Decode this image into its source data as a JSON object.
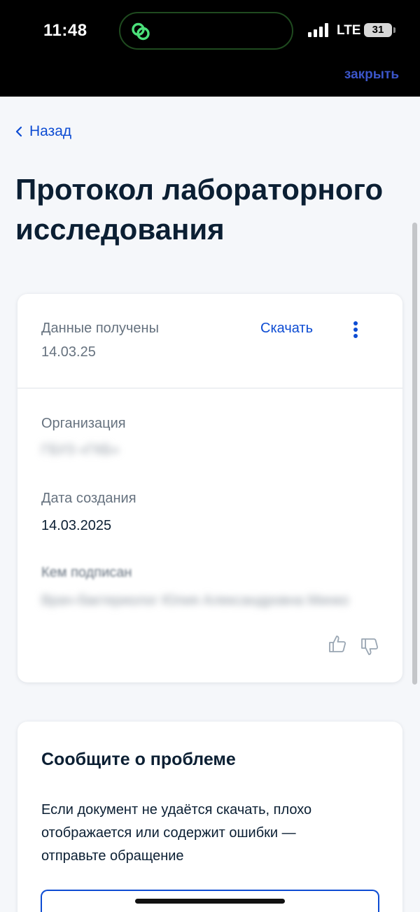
{
  "status_bar": {
    "time": "11:48",
    "network": "LTE",
    "battery": "31",
    "close_label": "закрыть"
  },
  "nav": {
    "back_label": "Назад"
  },
  "page": {
    "title": "Протокол лабораторного исследования"
  },
  "document_card": {
    "received_label": "Данные получены",
    "received_date": "14.03.25",
    "download_label": "Скачать",
    "fields": {
      "organization_label": "Организация",
      "organization_value": "ГБУЗ «ГКБ»",
      "created_label": "Дата создания",
      "created_value": "14.03.2025",
      "signed_label": "Кем подписан",
      "signed_value": "Врач-бактериолог Юлия Александровна Минко"
    }
  },
  "report_card": {
    "title": "Сообщите о проблеме",
    "text": "Если документ не удаётся скачать, плохо отображается или содержит ошибки — отправьте обращение"
  },
  "colors": {
    "accent": "#0d4cd3",
    "close_link": "#3b55c9",
    "text_primary": "#0b1f33",
    "text_secondary": "#66727f",
    "island_icon": "#4be07a"
  }
}
